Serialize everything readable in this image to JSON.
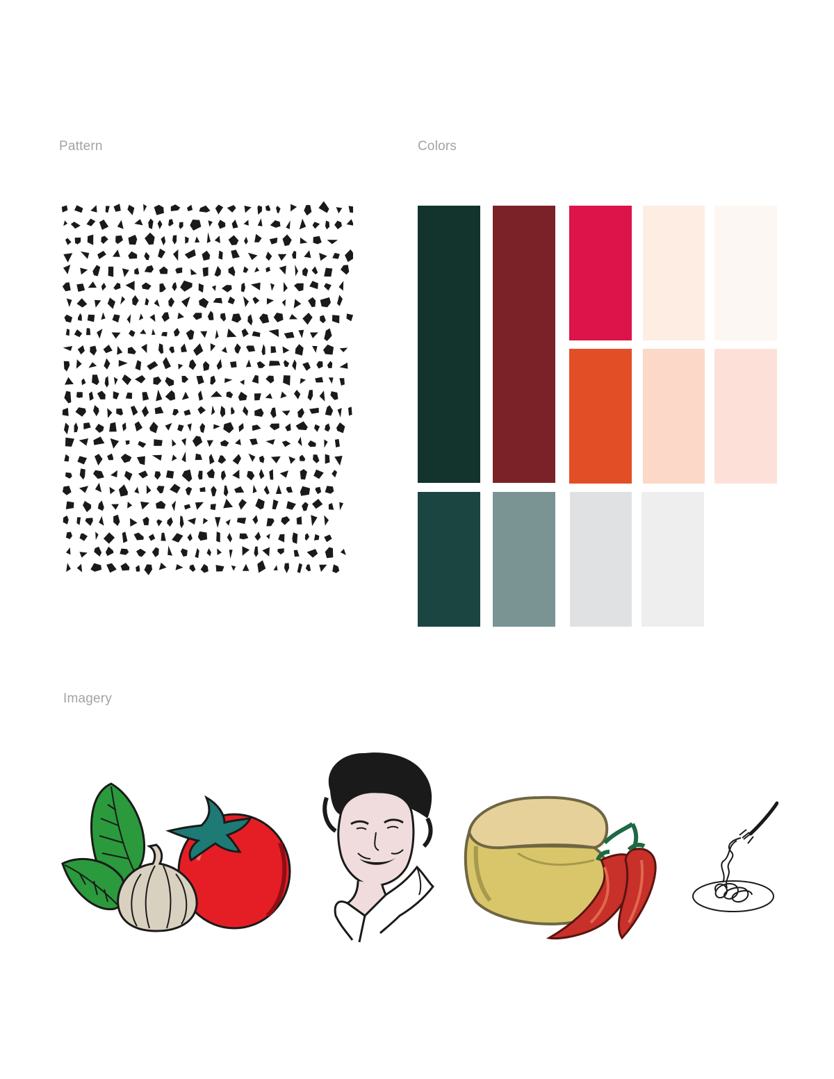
{
  "sections": {
    "pattern_label": "Pattern",
    "colors_label": "Colors",
    "imagery_label": "Imagery"
  },
  "palette": [
    "#13332d",
    "#7b2229",
    "#dd1449",
    "#fdede3",
    "#fdf7f3",
    "#e24f27",
    "#fcd8c8",
    "#fde1d9",
    "#1b4540",
    "#7a9393",
    "#e0e1e2",
    "#eeeeee"
  ],
  "imagery": [
    {
      "icon": "basil-tomato-garlic-illustration"
    },
    {
      "icon": "chef-portrait-illustration"
    },
    {
      "icon": "cheese-chili-illustration"
    },
    {
      "icon": "pasta-plate-fork-icon"
    }
  ]
}
